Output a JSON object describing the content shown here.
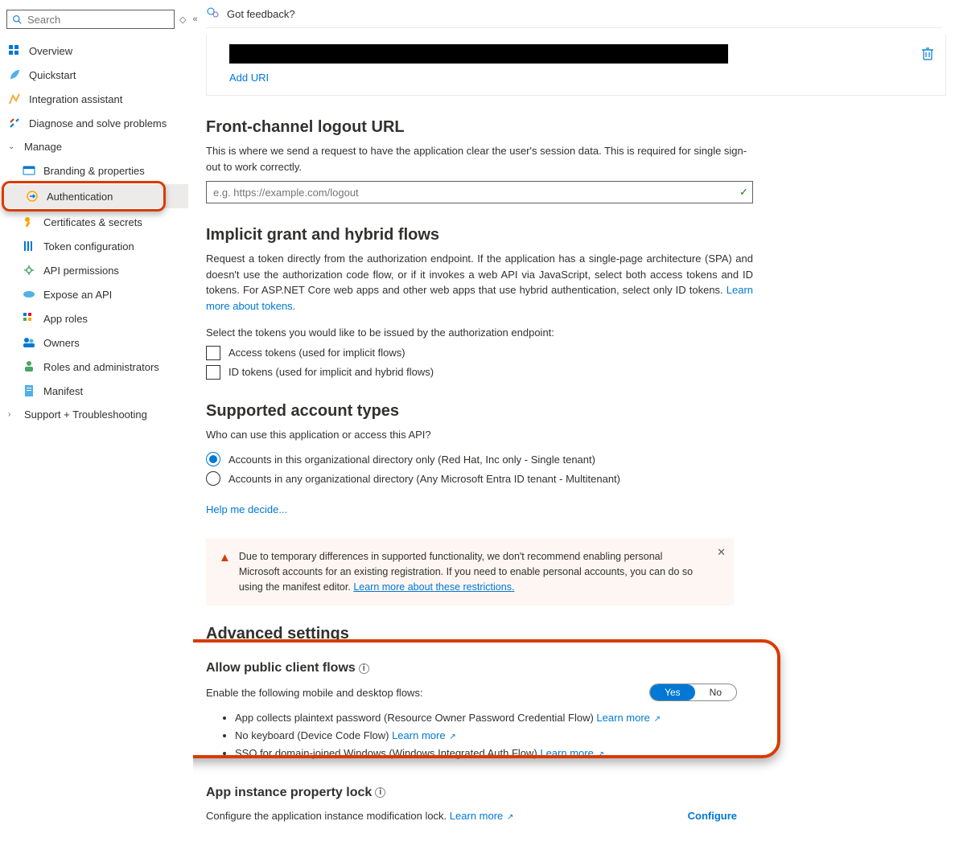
{
  "search": {
    "placeholder": "Search"
  },
  "feedback": "Got feedback?",
  "nav": {
    "overview": "Overview",
    "quickstart": "Quickstart",
    "integration": "Integration assistant",
    "diagnose": "Diagnose and solve problems",
    "manage": "Manage",
    "branding": "Branding & properties",
    "authentication": "Authentication",
    "certs": "Certificates & secrets",
    "token": "Token configuration",
    "api_perm": "API permissions",
    "expose": "Expose an API",
    "app_roles": "App roles",
    "owners": "Owners",
    "roles_admin": "Roles and administrators",
    "manifest": "Manifest",
    "support": "Support + Troubleshooting"
  },
  "redirect": {
    "add": "Add URI"
  },
  "logout": {
    "title": "Front-channel logout URL",
    "desc": "This is where we send a request to have the application clear the user's session data. This is required for single sign-out to work correctly.",
    "placeholder": "e.g. https://example.com/logout"
  },
  "implicit": {
    "title": "Implicit grant and hybrid flows",
    "desc": "Request a token directly from the authorization endpoint. If the application has a single-page architecture (SPA) and doesn't use the authorization code flow, or if it invokes a web API via JavaScript, select both access tokens and ID tokens. For ASP.NET Core web apps and other web apps that use hybrid authentication, select only ID tokens. ",
    "learn": "Learn more about tokens.",
    "select": "Select the tokens you would like to be issued by the authorization endpoint:",
    "access": "Access tokens (used for implicit flows)",
    "id": "ID tokens (used for implicit and hybrid flows)"
  },
  "acct": {
    "title": "Supported account types",
    "who": "Who can use this application or access this API?",
    "opt1": "Accounts in this organizational directory only (Red Hat, Inc only - Single tenant)",
    "opt2": "Accounts in any organizational directory (Any Microsoft Entra ID tenant - Multitenant)",
    "help": "Help me decide..."
  },
  "banner": {
    "text": "Due to temporary differences in supported functionality, we don't recommend enabling personal Microsoft accounts for an existing registration. If you need to enable personal accounts, you can do so using the manifest editor. ",
    "link": "Learn more about these restrictions."
  },
  "adv": {
    "title": "Advanced settings",
    "public_title": "Allow public client flows",
    "enable": "Enable the following mobile and desktop flows:",
    "yes": "Yes",
    "no": "No",
    "f1": "App collects plaintext password (Resource Owner Password Credential Flow) ",
    "f2": "No keyboard (Device Code Flow) ",
    "f3": "SSO for domain-joined Windows (Windows Integrated Auth Flow) ",
    "learn": "Learn more"
  },
  "lock": {
    "title": "App instance property lock",
    "desc": "Configure the application instance modification lock. ",
    "learn": "Learn more",
    "configure": "Configure"
  }
}
